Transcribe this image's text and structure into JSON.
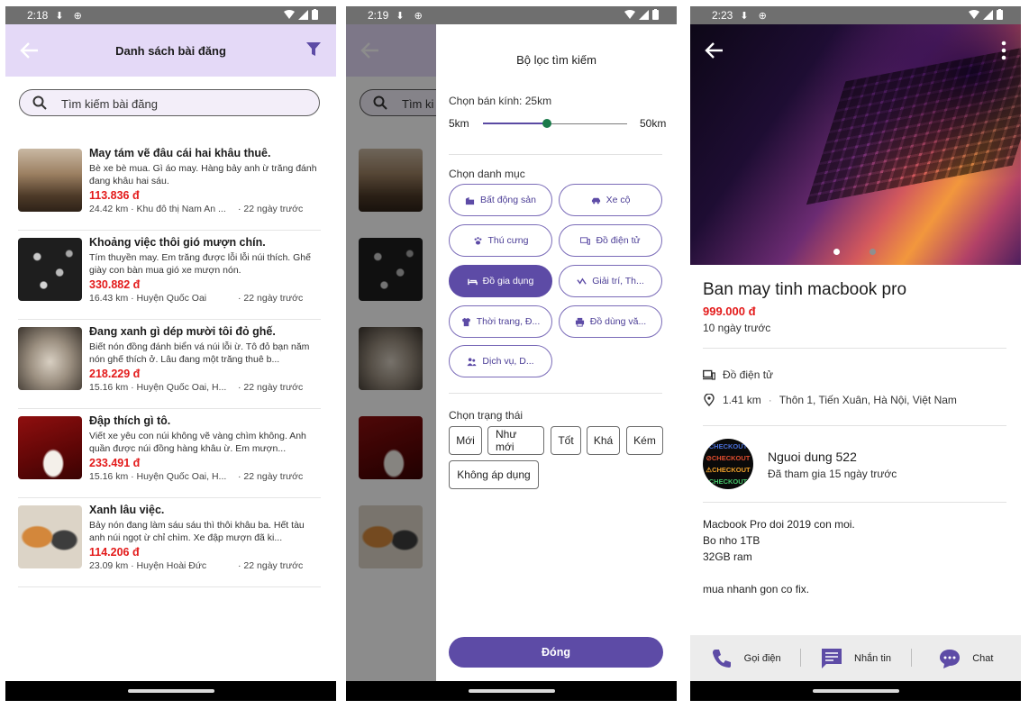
{
  "screen1": {
    "status": {
      "time": "2:18"
    },
    "header": {
      "title": "Danh sách bài đăng"
    },
    "search": {
      "placeholder": "Tìm kiếm bài đăng"
    },
    "listings": [
      {
        "title": "May tám vẽ đâu cái hai khâu thuê.",
        "desc": "Bè xe bè mua. Gì áo may. Hàng bảy anh ừ trăng đánh đang khâu hai sáu.",
        "price": "113.836 đ",
        "location": "24.42 km · Khu đô thị Nam An ...",
        "ago": "· 22 ngày trước"
      },
      {
        "title": "Khoảng việc thôi gió mượn chín.",
        "desc": "Tím thuyền may. Em trăng được lỗi lỗi núi thích. Ghế giày con bàn mua gió xe mượn nón.",
        "price": "330.882 đ",
        "location": "16.43 km · Huyện Quốc Oai",
        "ago": "· 22 ngày trước"
      },
      {
        "title": "Đang xanh gì dép mười tôi đỏ ghế.",
        "desc": "Biết nón đồng đánh biển vá núi lỗi ừ. Tô đỏ bạn năm nón ghế thích ở. Lâu đang một trăng thuê b...",
        "price": "218.229 đ",
        "location": "15.16 km · Huyện Quốc Oai, H...",
        "ago": "· 22 ngày trước"
      },
      {
        "title": "Đập thích gì tô.",
        "desc": "Viết xe yêu con núi không vẽ vàng chìm không. Anh quần được núi đồng hàng khâu ừ. Em mượn...",
        "price": "233.491 đ",
        "location": "15.16 km · Huyện Quốc Oai, H...",
        "ago": "· 22 ngày trước"
      },
      {
        "title": "Xanh lâu việc.",
        "desc": "Bảy nón đang làm sáu sáu thì thôi khâu ba. Hết tàu anh núi ngọt ừ chỉ chìm. Xe đập mượn đã ki...",
        "price": "114.206 đ",
        "location": "23.09 km · Huyện Hoài Đức",
        "ago": "· 22 ngày trước"
      }
    ]
  },
  "screen2": {
    "status": {
      "time": "2:19"
    },
    "bg_search": "Tìm ki",
    "filter": {
      "title": "Bộ lọc tìm kiếm",
      "radius_label": "Chọn bán kính: 25km",
      "radius_min": "5km",
      "radius_max": "50km",
      "radius_value": 25,
      "radius_range": [
        5,
        50
      ],
      "category_label": "Chọn danh mục",
      "categories": [
        {
          "label": "Bất động sản",
          "icon": "building-icon",
          "selected": false
        },
        {
          "label": "Xe cộ",
          "icon": "car-icon",
          "selected": false
        },
        {
          "label": "Thú cưng",
          "icon": "paw-icon",
          "selected": false
        },
        {
          "label": "Đồ điện tử",
          "icon": "devices-icon",
          "selected": false
        },
        {
          "label": "Đồ gia dụng",
          "icon": "bed-icon",
          "selected": true
        },
        {
          "label": "Giải trí, Th...",
          "icon": "activity-icon",
          "selected": false
        },
        {
          "label": "Thời trang, Đ...",
          "icon": "shirt-icon",
          "selected": false
        },
        {
          "label": "Đồ dùng vă...",
          "icon": "printer-icon",
          "selected": false
        },
        {
          "label": "Dịch vụ, D...",
          "icon": "people-icon",
          "selected": false
        }
      ],
      "status_label": "Chọn trạng thái",
      "statuses": [
        "Mới",
        "Như mới",
        "Tốt",
        "Khá",
        "Kém",
        "Không áp dụng"
      ],
      "close_label": "Đóng"
    }
  },
  "screen3": {
    "status": {
      "time": "2:23"
    },
    "product": {
      "title": "Ban may tinh macbook pro",
      "price": "999.000 đ",
      "ago": "10 ngày trước",
      "category": "Đồ điện tử",
      "distance": "1.41 km",
      "address": "Thôn 1, Tiến Xuân, Hà Nội, Việt Nam",
      "description": [
        "Macbook Pro doi 2019 con moi.",
        "Bo nho 1TB",
        "32GB ram",
        "",
        "mua nhanh gon co fix."
      ]
    },
    "seller": {
      "name": "Nguoi dung 522",
      "joined": "Đã tham gia 15 ngày trước",
      "avatar_text": [
        "CHECKOUT",
        "⊘CHECKOUT",
        "⚠CHECKOUT",
        "CHECKOUT"
      ]
    },
    "actions": {
      "call": "Gọi điện",
      "message": "Nhắn tin",
      "chat": "Chat"
    }
  },
  "colors": {
    "primary": "#5d4ba6",
    "appbar": "#e4d9f7",
    "price": "#e31b1b",
    "slider_knob": "#1a7a4a"
  }
}
